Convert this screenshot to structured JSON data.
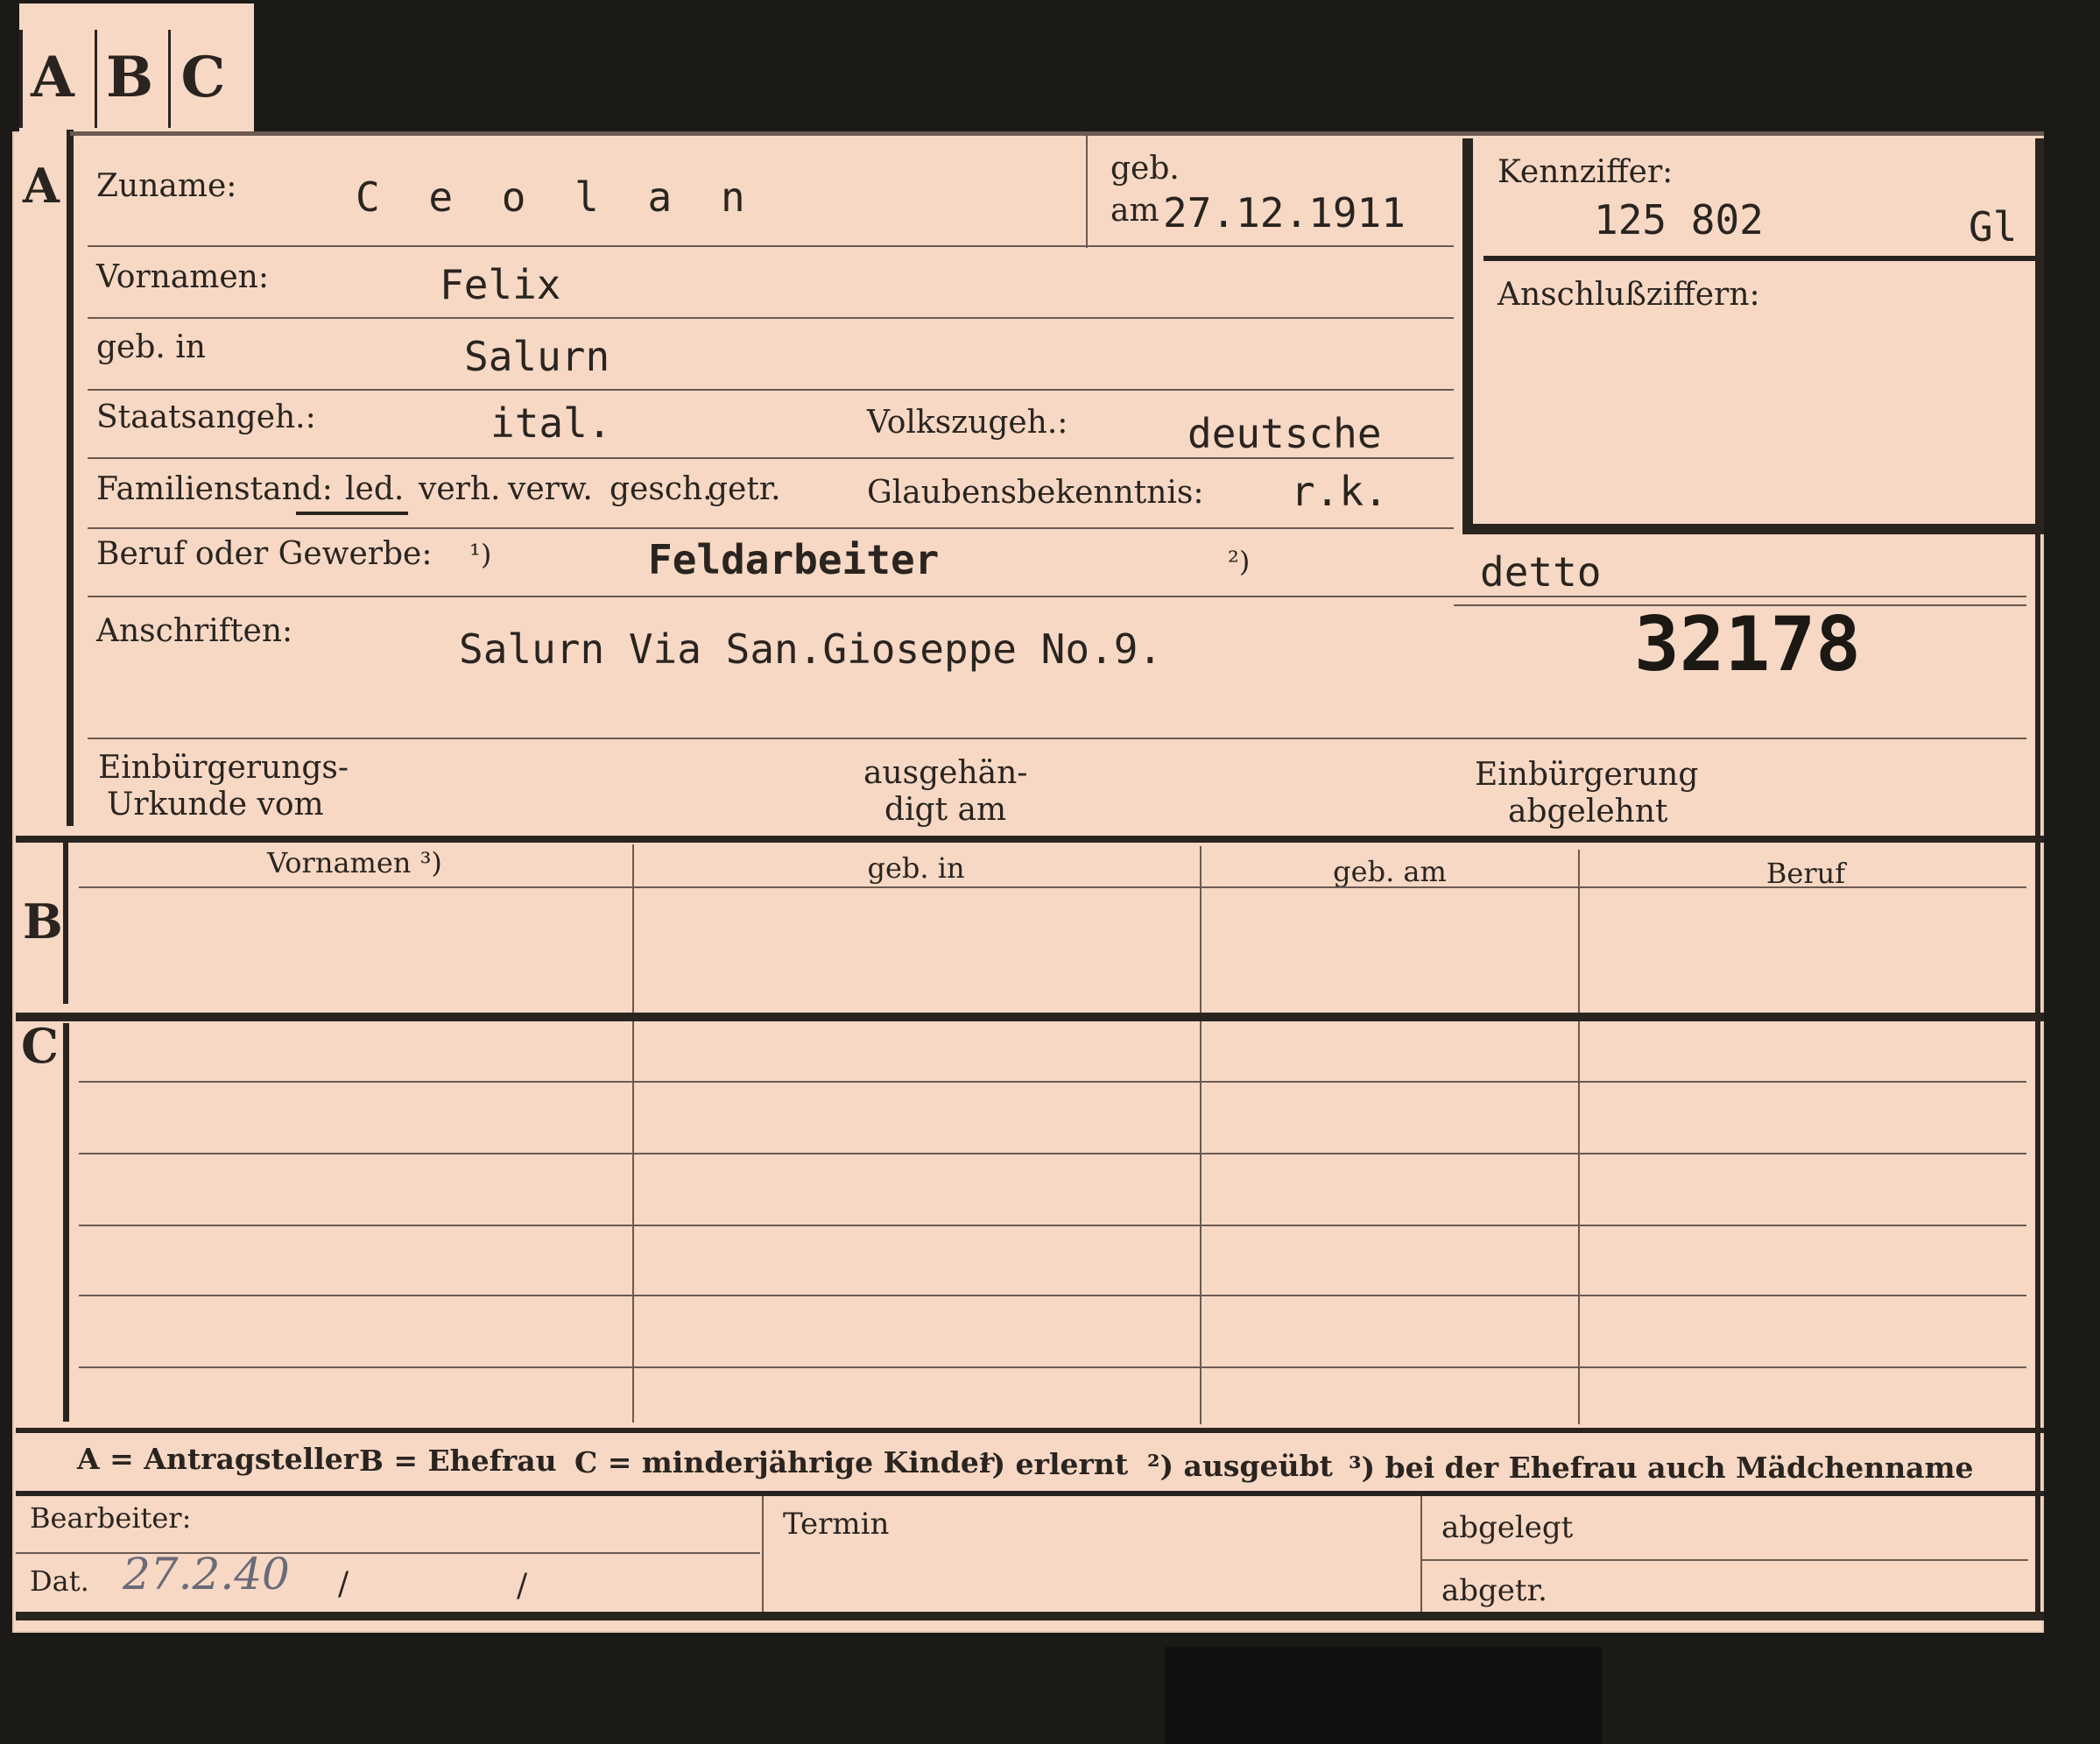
{
  "tabs": [
    "A",
    "B",
    "C"
  ],
  "section_a": {
    "letter": "A",
    "surname_label": "Zuname:",
    "surname_value": "C e o l a n",
    "birth_date_label_1": "geb.",
    "birth_date_label_2": "am",
    "birth_date_value": "27.12.1911",
    "firstname_label": "Vornamen:",
    "firstname_value": "Felix",
    "birthplace_label": "geb. in",
    "birthplace_value": "Salurn",
    "citizenship_label": "Staatsangeh.:",
    "citizenship_value": "ital.",
    "ethnicity_label": "Volkszugeh.:",
    "ethnicity_value": "deutsche",
    "marital_label": "Familienstand:",
    "marital_options": [
      "led.",
      "verh.",
      "verw.",
      "gesch.",
      "getr."
    ],
    "religion_label": "Glaubensbekenntnis:",
    "religion_value": "r.k.",
    "occupation_label": "Beruf oder Gewerbe:",
    "occupation_note1": "¹)",
    "occupation_value1": "Feldarbeiter",
    "occupation_note2": "²)",
    "occupation_value2": "detto",
    "address_label": "Anschriften:",
    "address_value": "Salurn Via San.Gioseppe No.9.",
    "stamp_number": "32178",
    "naturalization_certificate_label_1": "Einbürgerungs-",
    "naturalization_certificate_label_2": "Urkunde vom",
    "issued_label_1": "ausgehän-",
    "issued_label_2": "digt am",
    "rejected_label_1": "Einbürgerung",
    "rejected_label_2": "abgelehnt"
  },
  "id_box": {
    "code_label": "Kennziffer:",
    "code_value": "125 802",
    "code_suffix": "Gl",
    "related_label": "Anschlußziffern:"
  },
  "section_b": {
    "letter": "B",
    "columns": [
      "Vornamen ³)",
      "geb. in",
      "geb. am",
      "Beruf"
    ]
  },
  "section_c": {
    "letter": "C"
  },
  "legend": {
    "a": "A = Antragsteller",
    "b": "B = Ehefrau",
    "c": "C = minderjährige Kinder",
    "n1": "¹) erlernt",
    "n2": "²) ausgeübt",
    "n3": "³) bei der Ehefrau auch Mädchenname"
  },
  "footer": {
    "processor_label": "Bearbeiter:",
    "date_label": "Dat.",
    "date_value": "27.2.40",
    "slash1": "/",
    "slash2": "/",
    "deadline_label": "Termin",
    "filed_label": "abgelegt",
    "filed_out_label": "abgetr."
  },
  "colors": {
    "card": "#f6d8c4",
    "ink": "#2a2420",
    "background": "#1c1a16",
    "pencil": "#6a6a78"
  }
}
